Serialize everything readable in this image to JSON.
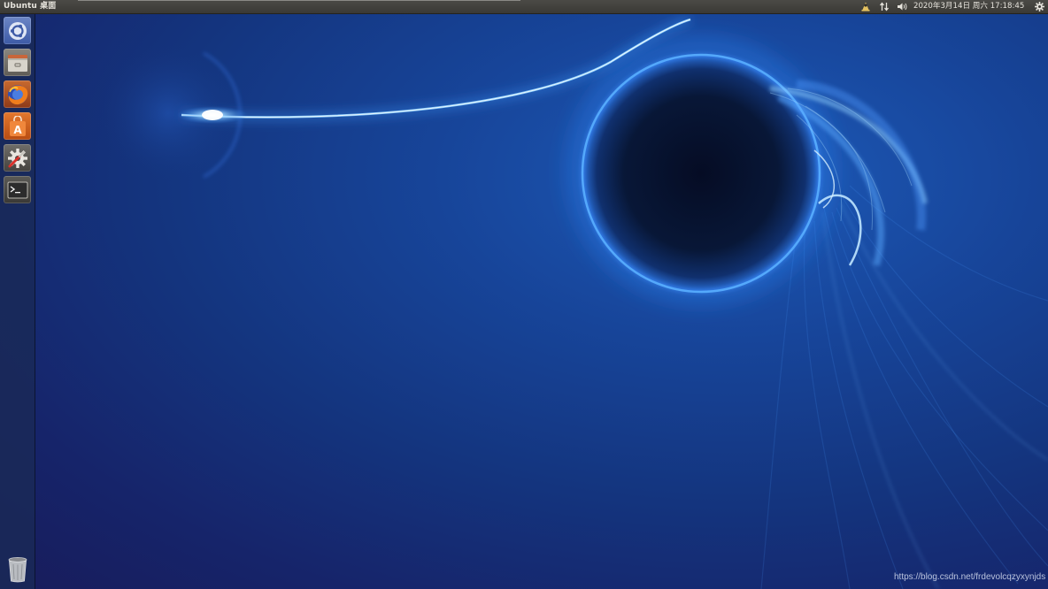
{
  "top_panel": {
    "title": "Ubuntu 桌面",
    "clock": "2020年3月14日 周六 17:18:45",
    "indicators": [
      {
        "icon": "input-method-icon"
      },
      {
        "icon": "network-icon"
      },
      {
        "icon": "volume-icon"
      },
      {
        "icon": "session-gear-icon"
      }
    ]
  },
  "launcher": {
    "items": [
      {
        "icon": "ubuntu-dash-icon"
      },
      {
        "icon": "files-icon"
      },
      {
        "icon": "firefox-icon"
      },
      {
        "icon": "ubuntu-software-icon"
      },
      {
        "icon": "system-settings-icon"
      },
      {
        "icon": "terminal-icon"
      },
      {
        "icon": "trash-icon"
      }
    ]
  },
  "desktop": {
    "watermark": "https://blog.csdn.net/frdevolcqzyxynjds"
  },
  "colors": {
    "panel": "#3c3b37",
    "launcher": "#1a2a57",
    "wallpaper_glow": "#5fb6ff",
    "wallpaper_base": "#14357f"
  }
}
